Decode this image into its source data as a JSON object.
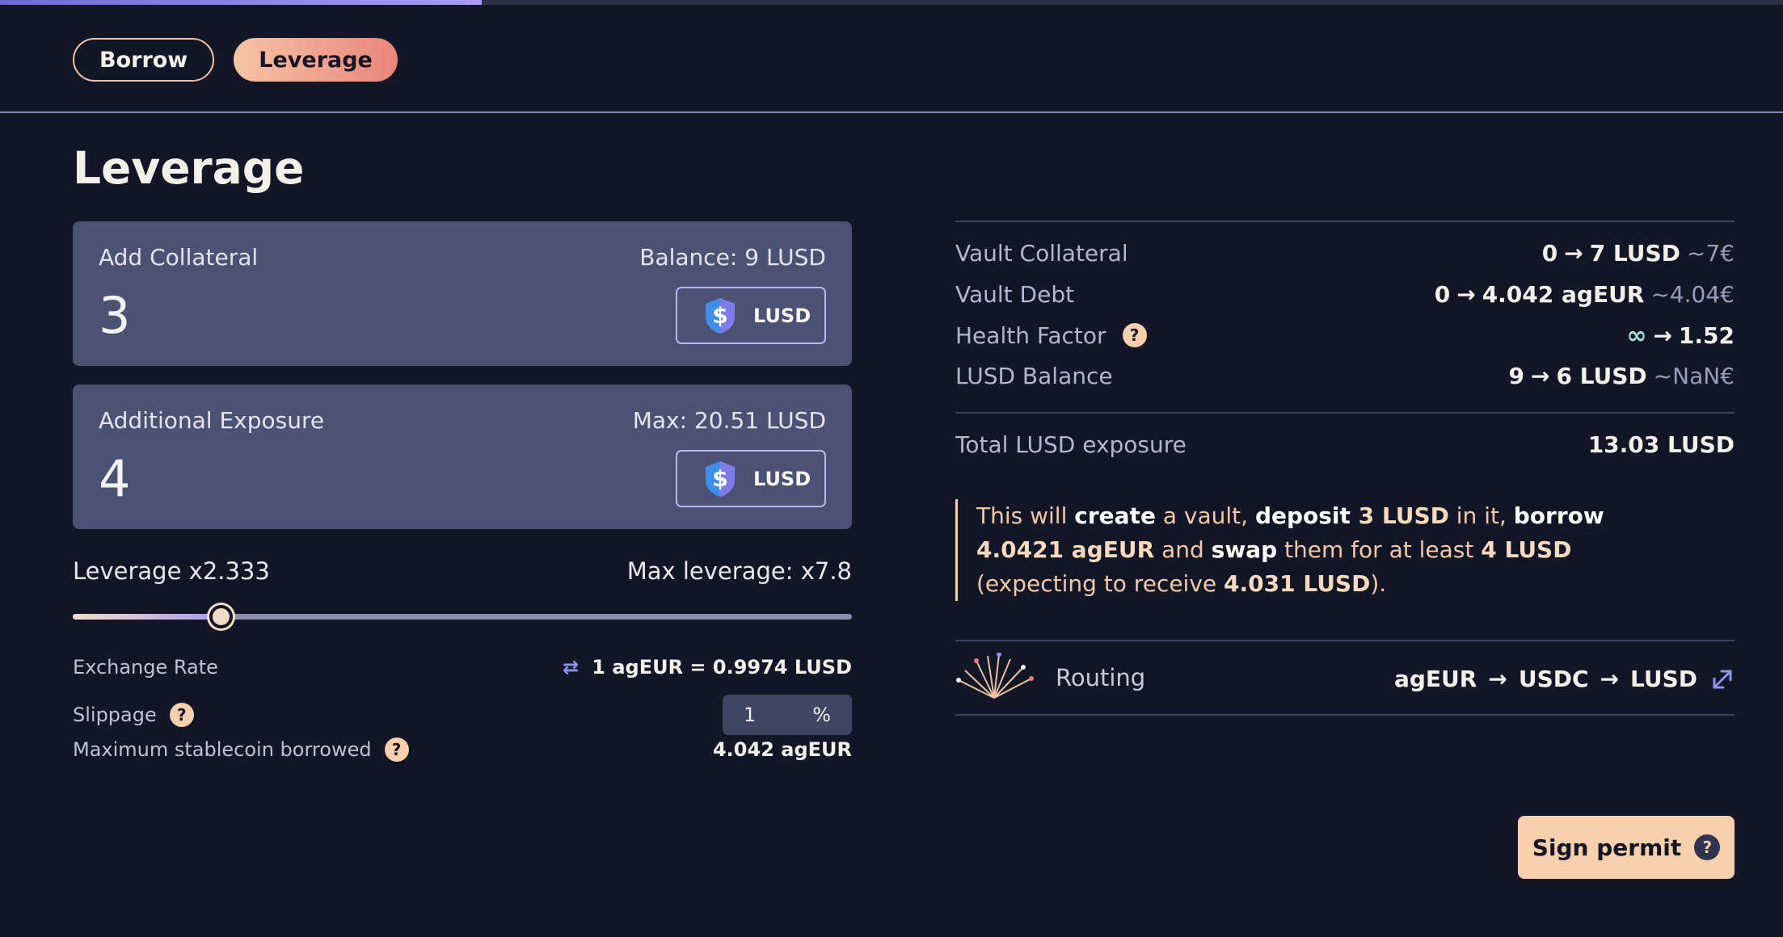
{
  "progress": {
    "fraction": 0.27
  },
  "tabs": [
    {
      "label": "Borrow",
      "active": false
    },
    {
      "label": "Leverage",
      "active": true
    }
  ],
  "page_title": "Leverage",
  "collateral": {
    "label": "Add Collateral",
    "balance": "Balance: 9 LUSD",
    "value": "3",
    "token": "LUSD"
  },
  "exposure": {
    "label": "Additional Exposure",
    "max": "Max: 20.51 LUSD",
    "value": "4",
    "token": "LUSD"
  },
  "leverage": {
    "label": "Leverage x2.333",
    "max": "Max leverage: x7.8",
    "slider_fraction": 0.19
  },
  "details": {
    "exchange_rate_label": "Exchange Rate",
    "exchange_rate_value": "1 agEUR = 0.9974 LUSD",
    "slippage_label": "Slippage",
    "slippage_value": "1",
    "slippage_unit": "%",
    "max_borrow_label": "Maximum stablecoin borrowed",
    "max_borrow_value": "4.042 agEUR"
  },
  "summary": {
    "vault_collateral": {
      "label": "Vault Collateral",
      "from": "0",
      "to": "7 LUSD",
      "fiat": "~7€"
    },
    "vault_debt": {
      "label": "Vault Debt",
      "from": "0",
      "to": "4.042 agEUR",
      "fiat": "~4.04€"
    },
    "health_factor": {
      "label": "Health Factor",
      "from": "∞",
      "to": "1.52"
    },
    "lusd_balance": {
      "label": "LUSD Balance",
      "from": "9",
      "to": "6 LUSD",
      "fiat": "~NaN€"
    },
    "total_exposure": {
      "label": "Total LUSD exposure",
      "value": "13.03 LUSD"
    }
  },
  "note": {
    "p1": "This will ",
    "create": "create",
    "p2": " a vault, ",
    "deposit": "deposit",
    "deposit_amt": " 3 LUSD",
    "p3": " in it, ",
    "borrow": "borrow",
    "borrow_amt": " 4.0421 agEUR",
    "p4": " and ",
    "swap": "swap",
    "p5": " them for at least ",
    "min_amt": "4 LUSD",
    "p6": " (expecting to receive ",
    "expected_amt": "4.031 LUSD",
    "p7": ")."
  },
  "routing": {
    "label": "Routing",
    "path": [
      "agEUR",
      "USDC",
      "LUSD"
    ]
  },
  "sign_button": {
    "label": "Sign permit",
    "help": "?"
  },
  "colors": {
    "accent": "#f6cfac",
    "card": "#4b5273",
    "background": "#131626"
  },
  "arrow_glyph": "→",
  "help_glyph": "?"
}
